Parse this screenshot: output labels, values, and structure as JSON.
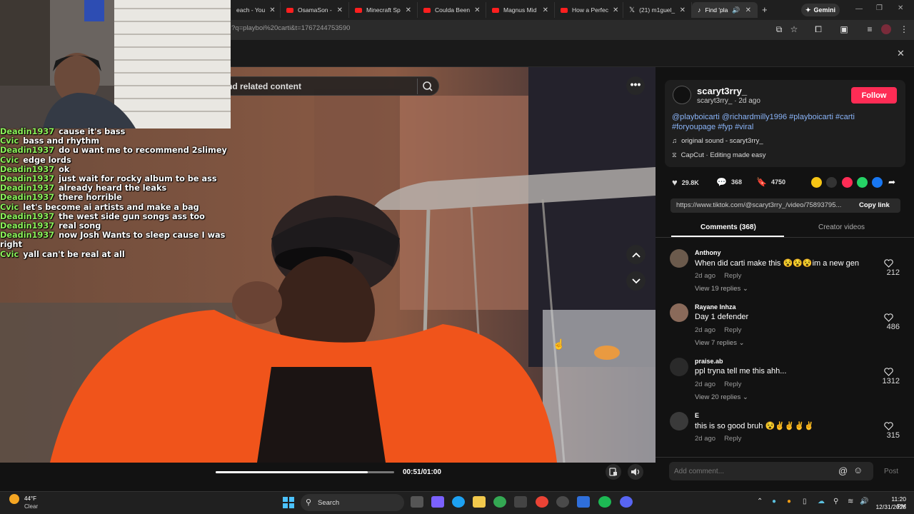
{
  "browser": {
    "tabs": [
      {
        "label": "each - You",
        "favicon": "youtube-icon"
      },
      {
        "label": "OsamaSon -",
        "favicon": "youtube-icon"
      },
      {
        "label": "Minecraft Sp",
        "favicon": "youtube-icon"
      },
      {
        "label": "Coulda Been",
        "favicon": "youtube-icon"
      },
      {
        "label": "Magnus Mid",
        "favicon": "youtube-icon"
      },
      {
        "label": "How a Perfec",
        "favicon": "youtube-icon"
      },
      {
        "label": "(21) m1guel_",
        "favicon": "x-icon"
      },
      {
        "label": "Find 'pla",
        "favicon": "tiktok-icon"
      }
    ],
    "gemini_label": "Gemini",
    "url": "?q=playboi%20carti&t=1767244753590"
  },
  "video": {
    "search_placeholder": "nd related content",
    "time": "00:51/01:00",
    "progress": 0.85
  },
  "chat": [
    {
      "user": "Deadin1937",
      "msg": "cause it's bass"
    },
    {
      "user": "Cvic",
      "msg": "bass and rhythm"
    },
    {
      "user": "Deadin1937",
      "msg": "do u want me to recommend 2slimey"
    },
    {
      "user": "Cvic",
      "msg": "edge lords"
    },
    {
      "user": "Deadin1937",
      "msg": "ok"
    },
    {
      "user": "Deadin1937",
      "msg": "just wait for rocky album to be ass"
    },
    {
      "user": "Deadin1937",
      "msg": "already heard the leaks"
    },
    {
      "user": "Deadin1937",
      "msg": "there horrible"
    },
    {
      "user": "Cvic",
      "msg": "let's become ai artists and make a bag"
    },
    {
      "user": "Deadin1937",
      "msg": "the west side gun songs ass too"
    },
    {
      "user": "Deadin1937",
      "msg": "real song"
    },
    {
      "user": "Deadin1937",
      "msg": "now Josh Wants to sleep cause I was right"
    },
    {
      "user": "Cvic",
      "msg": "yall can't be real at all"
    }
  ],
  "post": {
    "username": "scaryt3rry_",
    "subline": "scaryt3rry_ · 2d ago",
    "follow_label": "Follow",
    "caption": "@playboicarti @richardmilly1996 #playboicarti #carti #foryoupage #fyp #viral",
    "sound": "original sound - scaryt3rry_",
    "capcut": "CapCut · Editing made easy",
    "likes": "29.8K",
    "comments": "368",
    "saves": "4750",
    "link": "https://www.tiktok.com/@scaryt3rry_/video/75893795...",
    "copy_label": "Copy link"
  },
  "panel_tabs": {
    "comments": "Comments (368)",
    "creator": "Creator videos"
  },
  "comments": [
    {
      "name": "Anthony",
      "text": "When did carti make this 😵😵😵im a new gen",
      "age": "2d ago",
      "reply": "Reply",
      "views": "View 19 replies",
      "likes": "212"
    },
    {
      "name": "Rayane Inhza",
      "text": "Day 1 defender",
      "age": "2d ago",
      "reply": "Reply",
      "views": "View 7 replies",
      "likes": "486"
    },
    {
      "name": "praise.ab",
      "text": "ppl tryna tell me this ahh...",
      "age": "2d ago",
      "reply": "Reply",
      "views": "View 20 replies",
      "likes": "1312"
    },
    {
      "name": "E",
      "text": "this is so good bruh 😵✌✌✌✌",
      "age": "2d ago",
      "reply": "Reply",
      "views": "",
      "likes": "315"
    }
  ],
  "comment_box": {
    "placeholder": "Add comment...",
    "post_label": "Post"
  },
  "taskbar": {
    "temp": "44°F",
    "weather": "Clear",
    "search_label": "Search",
    "time": "11:20 PM",
    "date": "12/31/2025"
  }
}
